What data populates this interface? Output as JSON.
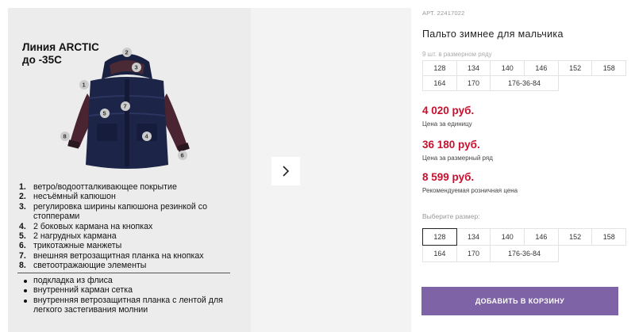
{
  "gallery": {
    "title_line1": "Линия ARCTIC",
    "title_line2": "до -35С",
    "markers": [
      "1",
      "2",
      "3",
      "4",
      "5",
      "6",
      "7",
      "8"
    ],
    "features": [
      {
        "num": "1.",
        "text": "ветро/водоотталкивающее покрытие"
      },
      {
        "num": "2.",
        "text": "несъёмный капюшон"
      },
      {
        "num": "3.",
        "text": "регулировка ширины капюшона  резинкой со стопперами"
      },
      {
        "num": "4.",
        "text": "2 боковых кармана на кнопках"
      },
      {
        "num": "5.",
        "text": "2 нагрудных кармана"
      },
      {
        "num": "6.",
        "text": "трикотажные манжеты"
      },
      {
        "num": "7.",
        "text": "внешняя ветрозащитная планка на кнопках"
      },
      {
        "num": "8.",
        "text": "светоотражающие элементы"
      }
    ],
    "extras": [
      "подкладка из флиса",
      "внутренний карман сетка",
      "внутренняя ветрозащитная планка с лентой для легкого застегивания молнии"
    ],
    "next_icon": "chevron-right-icon"
  },
  "product": {
    "article": "АРТ. 22417022",
    "title": "Пальто зимнее для мальчика",
    "pack_note": "9 шт. в размерном ряду",
    "pack_sizes": [
      "128",
      "134",
      "140",
      "146",
      "152",
      "158",
      "164",
      "170",
      "176-36-84"
    ],
    "price_unit": "4 020 руб.",
    "price_unit_label": "Цена за единицу",
    "price_pack": "36 180 руб.",
    "price_pack_label": "Цена за размерный ряд",
    "price_retail": "8 599 руб.",
    "price_retail_label": "Рекомендуемая розничная цена",
    "size_prompt": "Выберите размер:",
    "sizes": [
      "128",
      "134",
      "140",
      "146",
      "152",
      "158",
      "164",
      "170",
      "176-36-84"
    ],
    "selected_size": "128",
    "add_to_cart": "ДОБАВИТЬ В КОРЗИНУ",
    "colors": {
      "price": "#c8102e",
      "button": "#7e63a6"
    }
  }
}
